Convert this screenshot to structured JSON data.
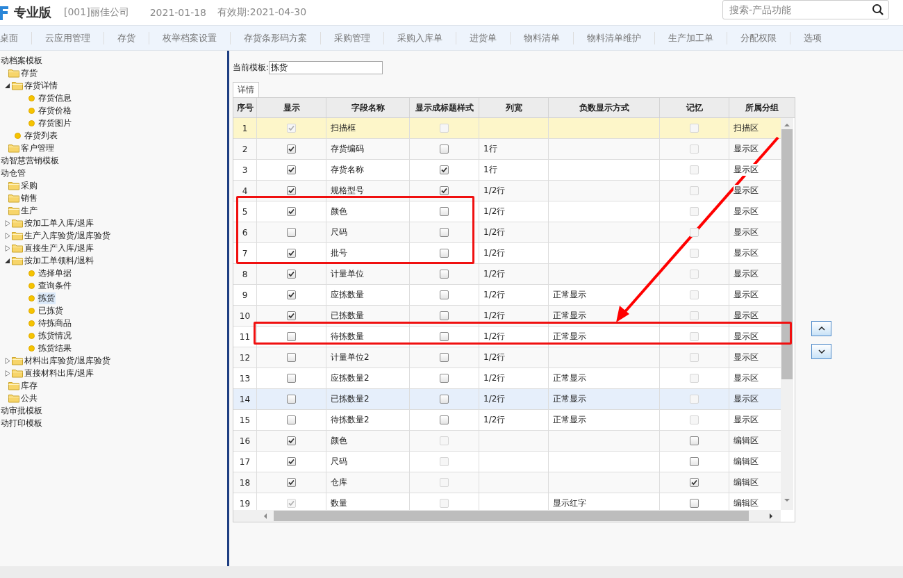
{
  "header": {
    "edition": "专业版",
    "company": "[001]丽佳公司",
    "date": "2021-01-18",
    "validity": "有效期:2021-04-30",
    "search": {
      "placeholder": "搜索-产品功能"
    }
  },
  "nav": [
    "桌面",
    "云应用管理",
    "存货",
    "枚举档案设置",
    "存货条形码方案",
    "采购管理",
    "采购入库单",
    "进货单",
    "物料清单",
    "物料清单维护",
    "生产加工单",
    "分配权限",
    "选项"
  ],
  "tree": [
    {
      "label": "动档案模板",
      "kind": "module",
      "selected": false,
      "children": [
        {
          "label": "存货",
          "kind": "folder",
          "selected": false,
          "children": [
            {
              "label": "存货详情",
              "kind": "folder",
              "expanded": true,
              "selected": false,
              "children": [
                {
                  "label": "存货信息",
                  "kind": "leaf",
                  "selected": false
                },
                {
                  "label": "存货价格",
                  "kind": "leaf",
                  "selected": false
                },
                {
                  "label": "存货图片",
                  "kind": "leaf",
                  "selected": false
                }
              ]
            },
            {
              "label": "存货列表",
              "kind": "leaf",
              "selected": false
            }
          ]
        },
        {
          "label": "客户管理",
          "kind": "folder",
          "selected": false
        }
      ]
    },
    {
      "label": "动智慧营销模板",
      "kind": "module",
      "selected": false
    },
    {
      "label": "动仓管",
      "kind": "module",
      "selected": false,
      "children": [
        {
          "label": "采购",
          "kind": "folder",
          "selected": false
        },
        {
          "label": "销售",
          "kind": "folder",
          "selected": false
        },
        {
          "label": "生产",
          "kind": "folder",
          "selected": false,
          "children": [
            {
              "label": "按加工单入库/退库",
              "kind": "folder",
              "expanded": false,
              "selected": false
            },
            {
              "label": "生产入库验货/退库验货",
              "kind": "folder",
              "expanded": false,
              "selected": false
            },
            {
              "label": "直接生产入库/退库",
              "kind": "folder",
              "expanded": false,
              "selected": false
            },
            {
              "label": "按加工单领料/退料",
              "kind": "folder",
              "expanded": true,
              "selected": false,
              "children": [
                {
                  "label": "选择单据",
                  "kind": "leaf",
                  "selected": false
                },
                {
                  "label": "查询条件",
                  "kind": "leaf",
                  "selected": false
                },
                {
                  "label": "拣货",
                  "kind": "leaf",
                  "selected": true
                },
                {
                  "label": "已拣货",
                  "kind": "leaf",
                  "selected": false
                },
                {
                  "label": "待拣商品",
                  "kind": "leaf",
                  "selected": false
                },
                {
                  "label": "拣货情况",
                  "kind": "leaf",
                  "selected": false
                },
                {
                  "label": "拣货结果",
                  "kind": "leaf",
                  "selected": false
                }
              ]
            },
            {
              "label": "材料出库验货/退库验货",
              "kind": "folder",
              "expanded": false,
              "selected": false
            },
            {
              "label": "直接材料出库/退库",
              "kind": "folder",
              "expanded": false,
              "selected": false
            }
          ]
        },
        {
          "label": "库存",
          "kind": "folder",
          "selected": false
        },
        {
          "label": "公共",
          "kind": "folder",
          "selected": false
        }
      ]
    },
    {
      "label": "动审批模板",
      "kind": "module",
      "selected": false
    },
    {
      "label": "动打印模板",
      "kind": "module",
      "selected": false
    }
  ],
  "template": {
    "label": "当前模板:",
    "value": "拣货"
  },
  "tabs": [
    {
      "label": "详情",
      "selected": true
    }
  ],
  "table": {
    "columns": [
      "序号",
      "显示",
      "字段名称",
      "显示成标题样式",
      "列宽",
      "负数显示方式",
      "记忆",
      "所属分组"
    ],
    "rows": [
      {
        "no": "1",
        "show": {
          "checked": true,
          "disabled": true
        },
        "field": "扫描框",
        "title_style": {
          "checked": false,
          "disabled": true
        },
        "width": "",
        "negative": "",
        "memory": {
          "checked": false,
          "disabled": true
        },
        "group": "扫描区",
        "selected": true,
        "hovered": false
      },
      {
        "no": "2",
        "show": {
          "checked": true,
          "disabled": false
        },
        "field": "存货编码",
        "title_style": {
          "checked": false,
          "disabled": false
        },
        "width": "1行",
        "negative": "",
        "memory": {
          "checked": false,
          "disabled": true
        },
        "group": "显示区",
        "selected": false,
        "hovered": false
      },
      {
        "no": "3",
        "show": {
          "checked": true,
          "disabled": false
        },
        "field": "存货名称",
        "title_style": {
          "checked": true,
          "disabled": false
        },
        "width": "1行",
        "negative": "",
        "memory": {
          "checked": false,
          "disabled": true
        },
        "group": "显示区",
        "selected": false,
        "hovered": false
      },
      {
        "no": "4",
        "show": {
          "checked": true,
          "disabled": false
        },
        "field": "规格型号",
        "title_style": {
          "checked": true,
          "disabled": false
        },
        "width": "1/2行",
        "negative": "",
        "memory": {
          "checked": false,
          "disabled": true
        },
        "group": "显示区",
        "selected": false,
        "hovered": false
      },
      {
        "no": "5",
        "show": {
          "checked": true,
          "disabled": false
        },
        "field": "颜色",
        "title_style": {
          "checked": false,
          "disabled": false
        },
        "width": "1/2行",
        "negative": "",
        "memory": {
          "checked": false,
          "disabled": true
        },
        "group": "显示区",
        "selected": false,
        "hovered": false
      },
      {
        "no": "6",
        "show": {
          "checked": false,
          "disabled": false
        },
        "field": "尺码",
        "title_style": {
          "checked": false,
          "disabled": false
        },
        "width": "1/2行",
        "negative": "",
        "memory": {
          "checked": false,
          "disabled": true
        },
        "group": "显示区",
        "selected": false,
        "hovered": false
      },
      {
        "no": "7",
        "show": {
          "checked": true,
          "disabled": false
        },
        "field": "批号",
        "title_style": {
          "checked": false,
          "disabled": false
        },
        "width": "1/2行",
        "negative": "",
        "memory": {
          "checked": false,
          "disabled": true
        },
        "group": "显示区",
        "selected": false,
        "hovered": false
      },
      {
        "no": "8",
        "show": {
          "checked": true,
          "disabled": false
        },
        "field": "计量单位",
        "title_style": {
          "checked": false,
          "disabled": false
        },
        "width": "1/2行",
        "negative": "",
        "memory": {
          "checked": false,
          "disabled": true
        },
        "group": "显示区",
        "selected": false,
        "hovered": false
      },
      {
        "no": "9",
        "show": {
          "checked": true,
          "disabled": false
        },
        "field": "应拣数量",
        "title_style": {
          "checked": false,
          "disabled": false
        },
        "width": "1/2行",
        "negative": "正常显示",
        "memory": {
          "checked": false,
          "disabled": true
        },
        "group": "显示区",
        "selected": false,
        "hovered": false
      },
      {
        "no": "10",
        "show": {
          "checked": true,
          "disabled": false
        },
        "field": "已拣数量",
        "title_style": {
          "checked": false,
          "disabled": false
        },
        "width": "1/2行",
        "negative": "正常显示",
        "memory": {
          "checked": false,
          "disabled": true
        },
        "group": "显示区",
        "selected": false,
        "hovered": false
      },
      {
        "no": "11",
        "show": {
          "checked": false,
          "disabled": false
        },
        "field": "待拣数量",
        "title_style": {
          "checked": false,
          "disabled": false
        },
        "width": "1/2行",
        "negative": "正常显示",
        "memory": {
          "checked": false,
          "disabled": true
        },
        "group": "显示区",
        "selected": false,
        "hovered": false
      },
      {
        "no": "12",
        "show": {
          "checked": false,
          "disabled": false
        },
        "field": "计量单位2",
        "title_style": {
          "checked": false,
          "disabled": false
        },
        "width": "1/2行",
        "negative": "",
        "memory": {
          "checked": false,
          "disabled": true
        },
        "group": "显示区",
        "selected": false,
        "hovered": false
      },
      {
        "no": "13",
        "show": {
          "checked": false,
          "disabled": false
        },
        "field": "应拣数量2",
        "title_style": {
          "checked": false,
          "disabled": false
        },
        "width": "1/2行",
        "negative": "正常显示",
        "memory": {
          "checked": false,
          "disabled": true
        },
        "group": "显示区",
        "selected": false,
        "hovered": false
      },
      {
        "no": "14",
        "show": {
          "checked": false,
          "disabled": false
        },
        "field": "已拣数量2",
        "title_style": {
          "checked": false,
          "disabled": false
        },
        "width": "1/2行",
        "negative": "正常显示",
        "memory": {
          "checked": false,
          "disabled": true
        },
        "group": "显示区",
        "selected": false,
        "hovered": true
      },
      {
        "no": "15",
        "show": {
          "checked": false,
          "disabled": false
        },
        "field": "待拣数量2",
        "title_style": {
          "checked": false,
          "disabled": false
        },
        "width": "1/2行",
        "negative": "正常显示",
        "memory": {
          "checked": false,
          "disabled": true
        },
        "group": "显示区",
        "selected": false,
        "hovered": false
      },
      {
        "no": "16",
        "show": {
          "checked": true,
          "disabled": false
        },
        "field": "颜色",
        "title_style": {
          "checked": false,
          "disabled": true
        },
        "width": "",
        "negative": "",
        "memory": {
          "checked": false,
          "disabled": false
        },
        "group": "编辑区",
        "selected": false,
        "hovered": false
      },
      {
        "no": "17",
        "show": {
          "checked": true,
          "disabled": false
        },
        "field": "尺码",
        "title_style": {
          "checked": false,
          "disabled": true
        },
        "width": "",
        "negative": "",
        "memory": {
          "checked": false,
          "disabled": false
        },
        "group": "编辑区",
        "selected": false,
        "hovered": false
      },
      {
        "no": "18",
        "show": {
          "checked": true,
          "disabled": false
        },
        "field": "仓库",
        "title_style": {
          "checked": false,
          "disabled": true
        },
        "width": "",
        "negative": "",
        "memory": {
          "checked": true,
          "disabled": false
        },
        "group": "编辑区",
        "selected": false,
        "hovered": false
      },
      {
        "no": "19",
        "show": {
          "checked": true,
          "disabled": true
        },
        "field": "数量",
        "title_style": {
          "checked": false,
          "disabled": true
        },
        "width": "",
        "negative": "显示红字",
        "memory": {
          "checked": false,
          "disabled": false
        },
        "group": "编辑区",
        "selected": false,
        "hovered": false
      }
    ]
  },
  "annotations": [
    {
      "kind": "box"
    },
    {
      "kind": "box"
    },
    {
      "kind": "arrow"
    }
  ]
}
